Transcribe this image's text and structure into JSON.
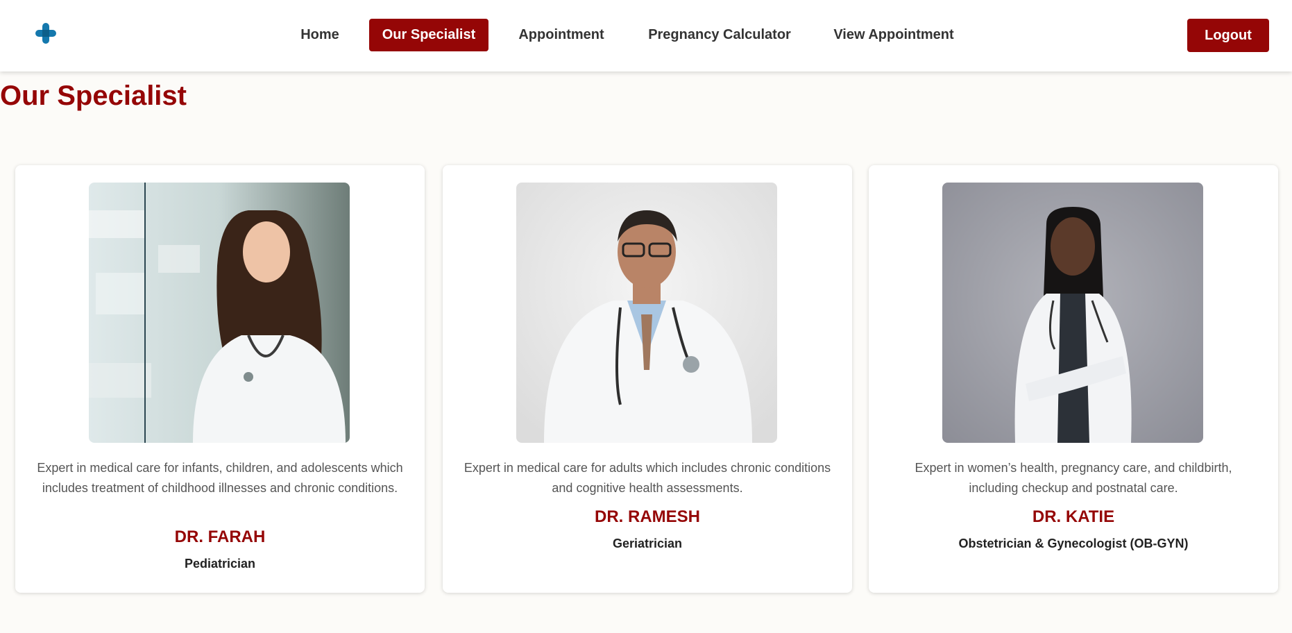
{
  "nav": {
    "items": [
      {
        "label": "Home"
      },
      {
        "label": "Our Specialist",
        "active": true
      },
      {
        "label": "Appointment"
      },
      {
        "label": "Pregnancy Calculator"
      },
      {
        "label": "View Appointment"
      }
    ],
    "logout_label": "Logout",
    "logo_icon": "medical-cross-icon"
  },
  "page": {
    "title": "Our Specialist"
  },
  "specialists": [
    {
      "description": "Expert in medical care for infants, children, and adolescents which includes treatment of childhood illnesses and chronic conditions.",
      "name": "DR. FARAH",
      "specialty": "Pediatrician"
    },
    {
      "description": "Expert in medical care for adults which includes chronic conditions and cognitive health assessments.",
      "name": "DR. RAMESH",
      "specialty": "Geriatrician"
    },
    {
      "description": "Expert in women’s health, pregnancy care, and childbirth, including checkup and postnatal care.",
      "name": "DR. KATIE",
      "specialty": "Obstetrician & Gynecologist (OB-GYN)"
    }
  ],
  "colors": {
    "brand": "#950606",
    "logo_blue": "#1478ad",
    "background": "#fcfbf8"
  }
}
